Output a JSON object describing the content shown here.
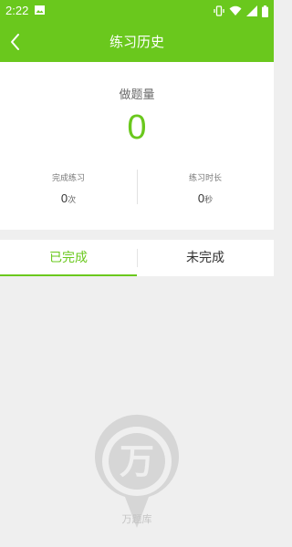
{
  "status_bar": {
    "time": "2:22",
    "icons": [
      "image-icon",
      "vibrate-icon",
      "wifi-icon",
      "signal-icon",
      "battery-icon"
    ]
  },
  "header": {
    "title": "练习历史",
    "back_icon": "chevron-left-icon"
  },
  "summary": {
    "label": "做题量",
    "count": "0",
    "stats": [
      {
        "label": "完成练习",
        "value": "0",
        "unit": "次"
      },
      {
        "label": "练习时长",
        "value": "0",
        "unit": "秒"
      }
    ]
  },
  "tabs": [
    {
      "label": "已完成",
      "active": true
    },
    {
      "label": "未完成",
      "active": false
    }
  ],
  "empty_state": {
    "icon": "wanfang-logo-icon",
    "logo_char": "万",
    "text": "万题库"
  },
  "colors": {
    "accent": "#6ac81d",
    "background": "#efefef",
    "logo": "#d6d6d6"
  }
}
